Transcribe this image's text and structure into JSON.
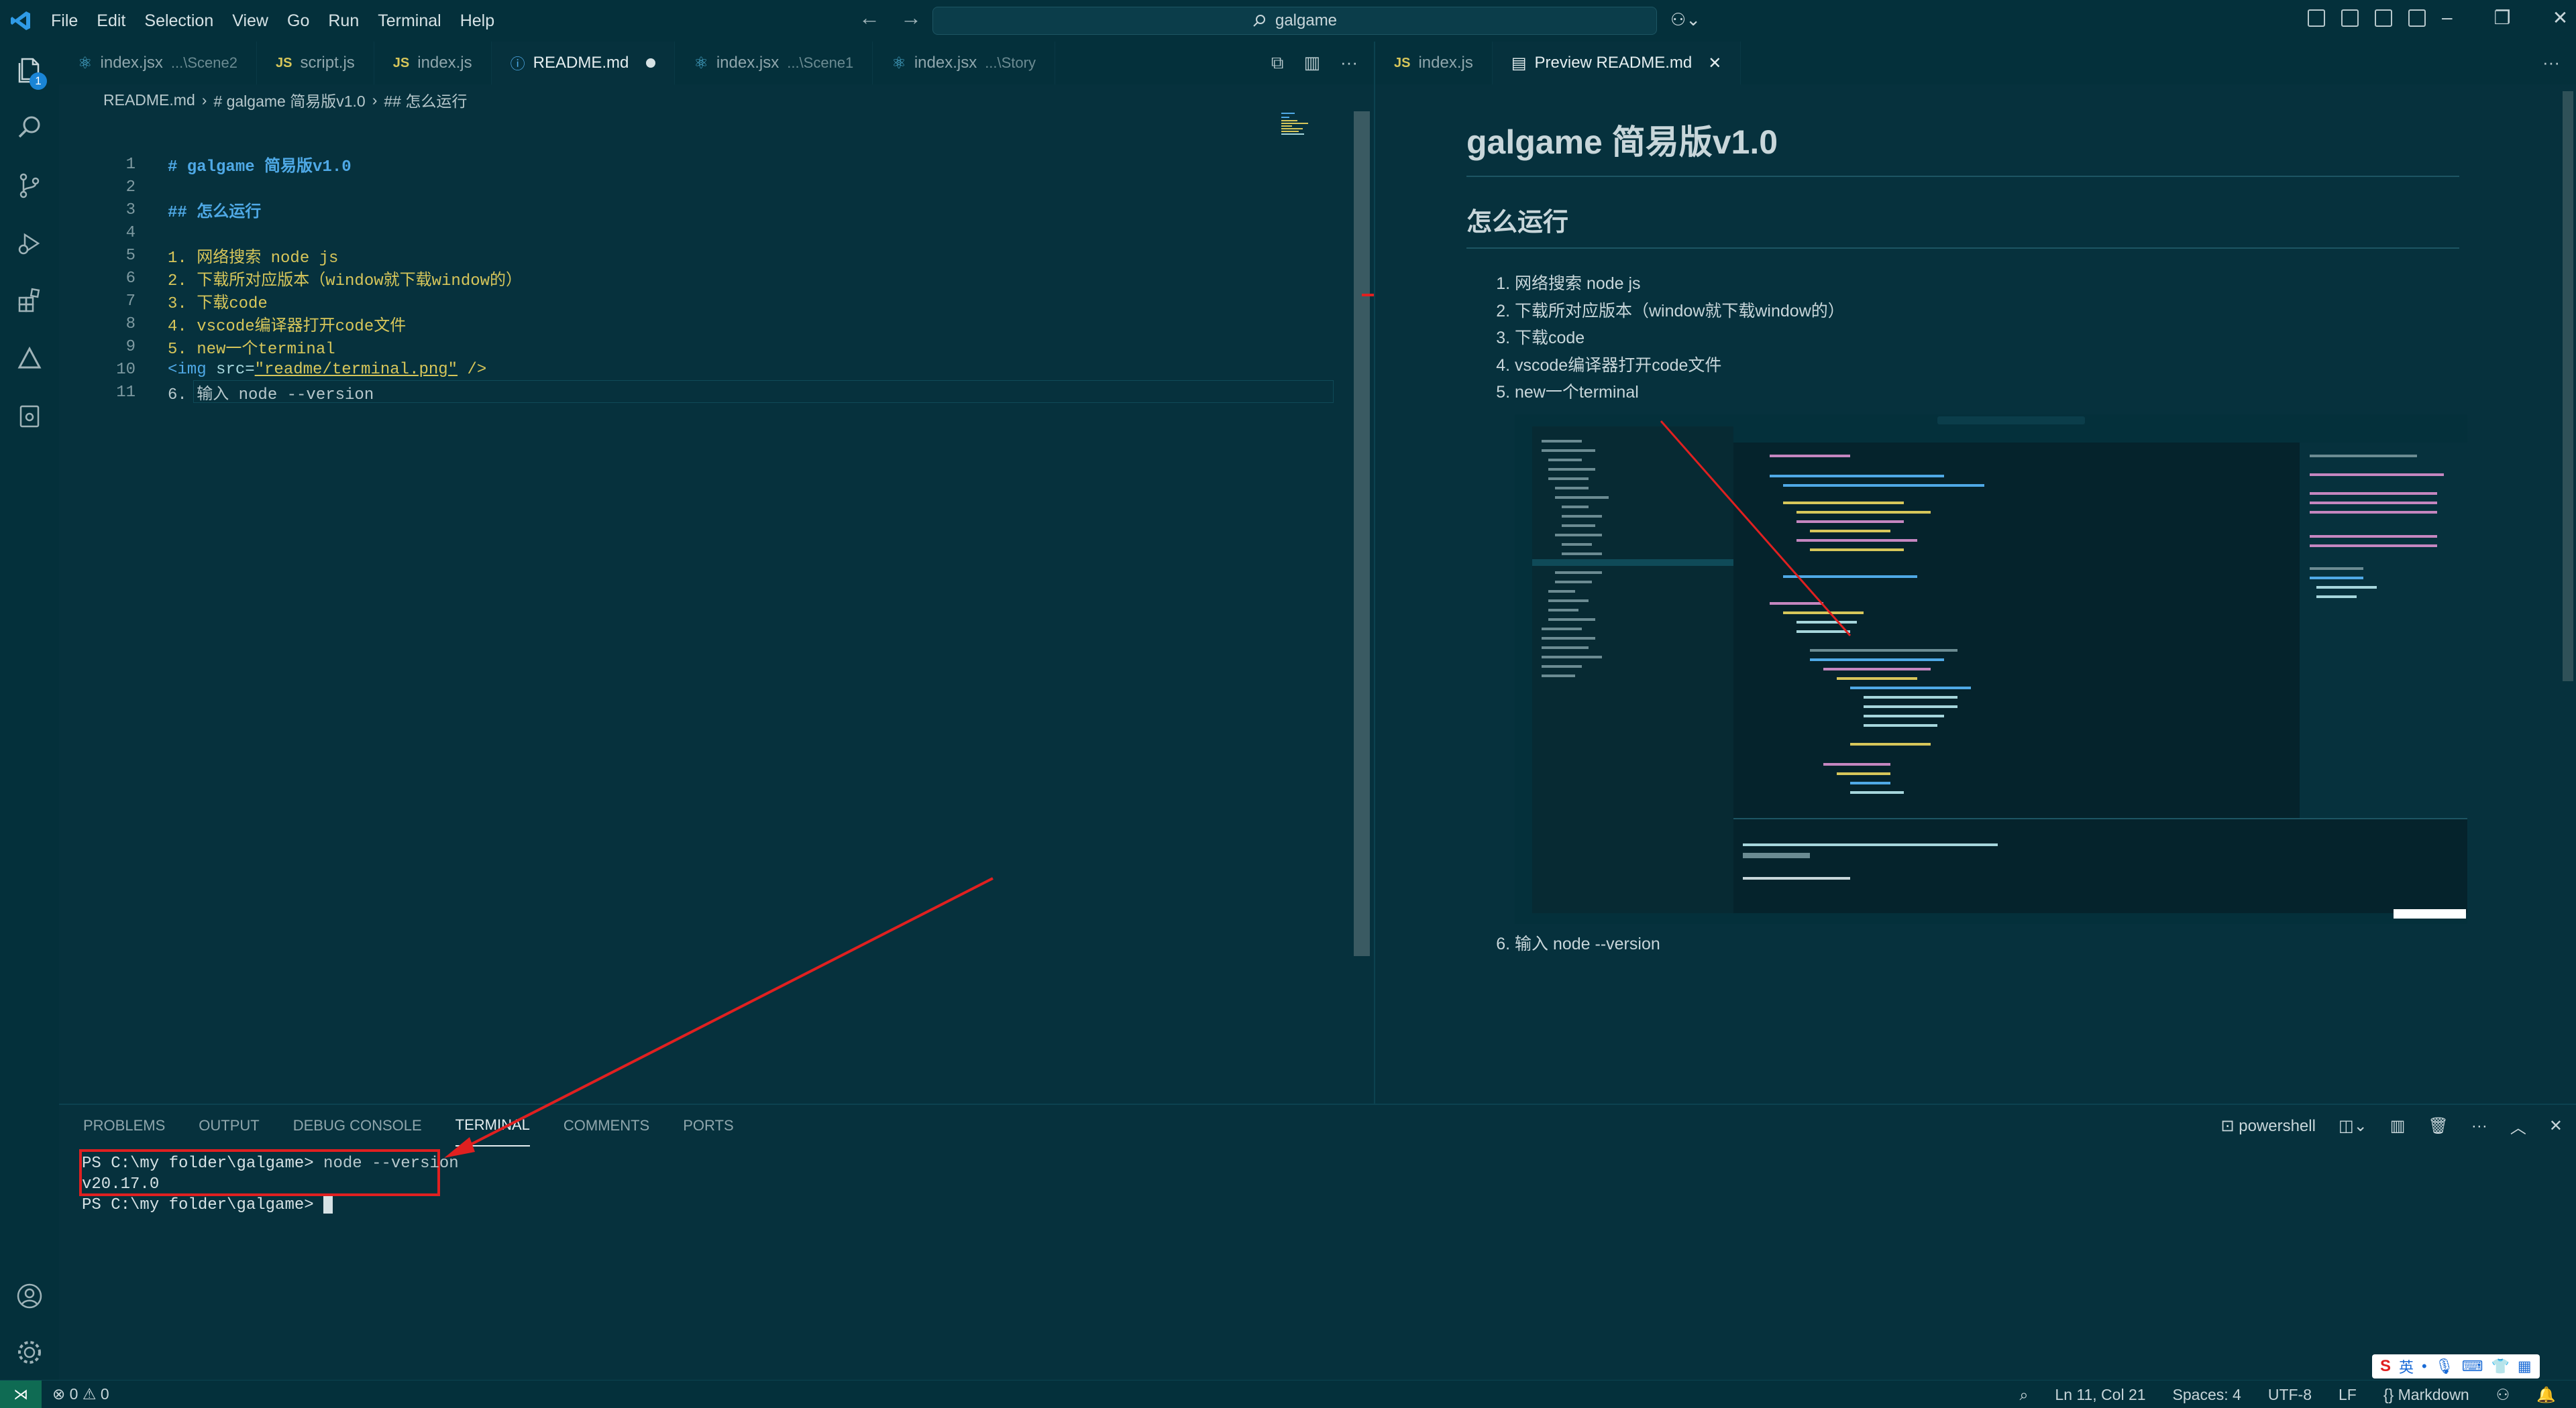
{
  "menu": [
    "File",
    "Edit",
    "Selection",
    "View",
    "Go",
    "Run",
    "Terminal",
    "Help"
  ],
  "search": {
    "text": "galgame"
  },
  "explorer_badge": "1",
  "left_tabs": [
    {
      "icon": "react",
      "label": "index.jsx",
      "hint": "...\\Scene2"
    },
    {
      "icon": "js",
      "label": "script.js",
      "hint": ""
    },
    {
      "icon": "js",
      "label": "index.js",
      "hint": ""
    },
    {
      "icon": "md",
      "label": "README.md",
      "hint": "",
      "active": true,
      "dirty": true
    },
    {
      "icon": "react",
      "label": "index.jsx",
      "hint": "...\\Scene1"
    },
    {
      "icon": "react",
      "label": "index.jsx",
      "hint": "...\\Story"
    }
  ],
  "right_tabs": [
    {
      "icon": "js",
      "label": "index.js"
    },
    {
      "icon": "preview",
      "label": "Preview README.md",
      "active": true
    }
  ],
  "breadcrumb": [
    "README.md",
    "# galgame 简易版v1.0",
    "## 怎么运行"
  ],
  "code_lines": [
    {
      "n": "1",
      "text": "# galgame 简易版v1.0"
    },
    {
      "n": "2",
      "text": ""
    },
    {
      "n": "3",
      "text": "## 怎么运行"
    },
    {
      "n": "4",
      "text": ""
    },
    {
      "n": "5",
      "text": "1. 网络搜索 node js"
    },
    {
      "n": "6",
      "text": "2. 下载所对应版本（window就下载window的）"
    },
    {
      "n": "7",
      "text": "3. 下载code"
    },
    {
      "n": "8",
      "text": "4. vscode编译器打开code文件"
    },
    {
      "n": "9",
      "text": "5. new一个terminal"
    },
    {
      "n": "10",
      "tag": "<img",
      "attr": " src=",
      "value": "\"readme/terminal.png\"",
      "close": " />"
    },
    {
      "n": "11",
      "text": "6. 输入 node --version"
    }
  ],
  "preview": {
    "h1": "galgame 简易版v1.0",
    "h2": "怎么运行",
    "items": [
      "网络搜索 node js",
      "下载所对应版本（window就下载window的）",
      "下载code",
      "vscode编译器打开code文件",
      "new一个terminal"
    ],
    "item6": "输入 node --version"
  },
  "panel_tabs": [
    "PROBLEMS",
    "OUTPUT",
    "DEBUG CONSOLE",
    "TERMINAL",
    "COMMENTS",
    "PORTS"
  ],
  "panel_active": "TERMINAL",
  "terminal_profile": "powershell",
  "terminal": {
    "prompt1": "PS C:\\my folder\\galgame>",
    "cmd1": " node --version",
    "output": "v20.17.0",
    "prompt2": "PS C:\\my folder\\galgame>"
  },
  "status": {
    "problems": "⊗ 0 ⚠ 0",
    "position": "Ln 11, Col 21",
    "spaces": "Spaces: 4",
    "encoding": "UTF-8",
    "eol": "LF",
    "language": "Markdown"
  },
  "ime": {
    "lang": "英"
  },
  "colors": {
    "accent": "#1a85d6",
    "annotation": "#e02020",
    "bg": "#06313d"
  }
}
